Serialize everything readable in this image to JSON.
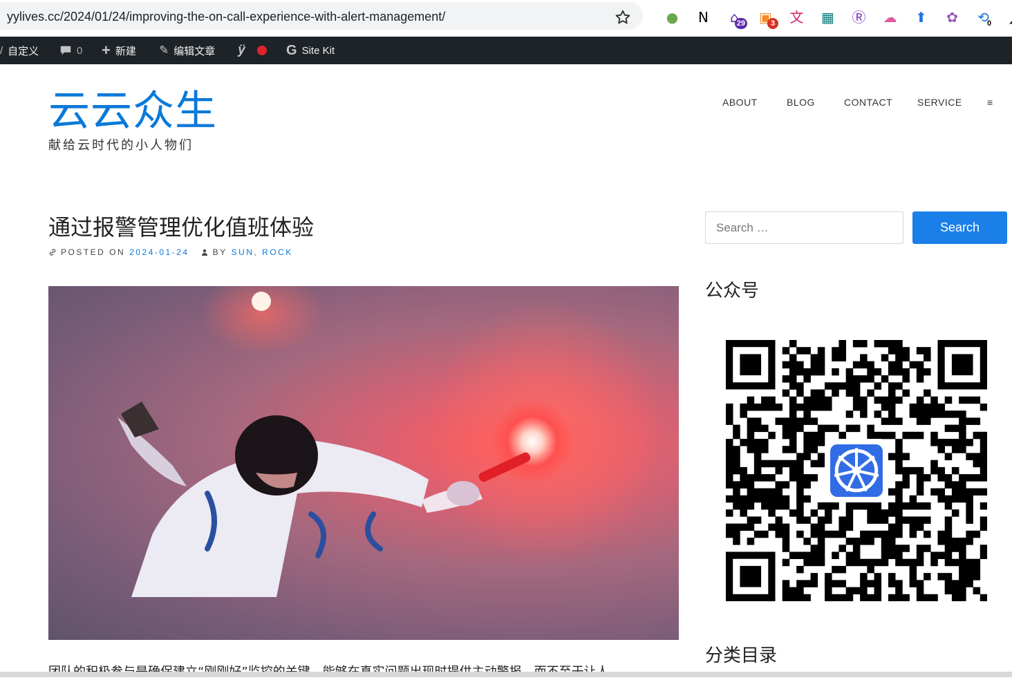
{
  "browser": {
    "url": "yylives.cc/2024/01/24/improving-the-on-call-experience-with-alert-management/",
    "extensions": [
      {
        "icon": "green-circle-extension-icon",
        "glyph": "●",
        "color": "#6aa84f",
        "badge": ""
      },
      {
        "icon": "notion-icon",
        "glyph": "N",
        "color": "#000000",
        "badge": ""
      },
      {
        "icon": "house-extension-icon",
        "glyph": "⌂",
        "color": "#5b2aa8",
        "badge": "29"
      },
      {
        "icon": "stack-extension-icon",
        "glyph": "▣",
        "color": "#f28c28",
        "badge": "3"
      },
      {
        "icon": "translate-icon",
        "glyph": "文",
        "color": "#d61f6b",
        "badge": ""
      },
      {
        "icon": "pattern-extension-icon",
        "glyph": "▦",
        "color": "#0f7d7d",
        "badge": ""
      },
      {
        "icon": "purple-r-extension-icon",
        "glyph": "Ⓡ",
        "color": "#7b2fbf",
        "badge": ""
      },
      {
        "icon": "cloud-face-extension-icon",
        "glyph": "☁",
        "color": "#e05a9c",
        "badge": ""
      },
      {
        "icon": "blue-arrow-extension-icon",
        "glyph": "⬆",
        "color": "#1a73e8",
        "badge": ""
      },
      {
        "icon": "openai-icon",
        "glyph": "✿",
        "color": "#9b59b6",
        "badge": ""
      },
      {
        "icon": "cycle-extension-icon",
        "glyph": "⟲",
        "color": "#1a73e8",
        "badge": "0"
      },
      {
        "icon": "dark-extension-icon",
        "glyph": "◢",
        "color": "#222222",
        "badge": ""
      }
    ]
  },
  "admin_bar": {
    "customize": "自定义",
    "comments_count": "0",
    "new": "新建",
    "edit_post": "编辑文章",
    "site_kit": "Site Kit"
  },
  "site": {
    "title": "云云众生",
    "tagline": "献给云时代的小人物们"
  },
  "nav": {
    "items": [
      "ABOUT",
      "BLOG",
      "CONTACT",
      "SERVICE"
    ],
    "menu_icon": "≡"
  },
  "post": {
    "title": "通过报警管理优化值班体验",
    "posted_on_label": "POSTED ON",
    "date": "2024-01-24",
    "by_label": "BY",
    "authors": "SUN, ROCK",
    "intro": "团队的积极参与是确保建立“刚刚好”监控的关键，能够在真实问题出现时提供主动警报，而不至于让人"
  },
  "sidebar": {
    "search_placeholder": "Search …",
    "search_button": "Search",
    "wechat_title": "公众号",
    "categories_title": "分类目录"
  }
}
